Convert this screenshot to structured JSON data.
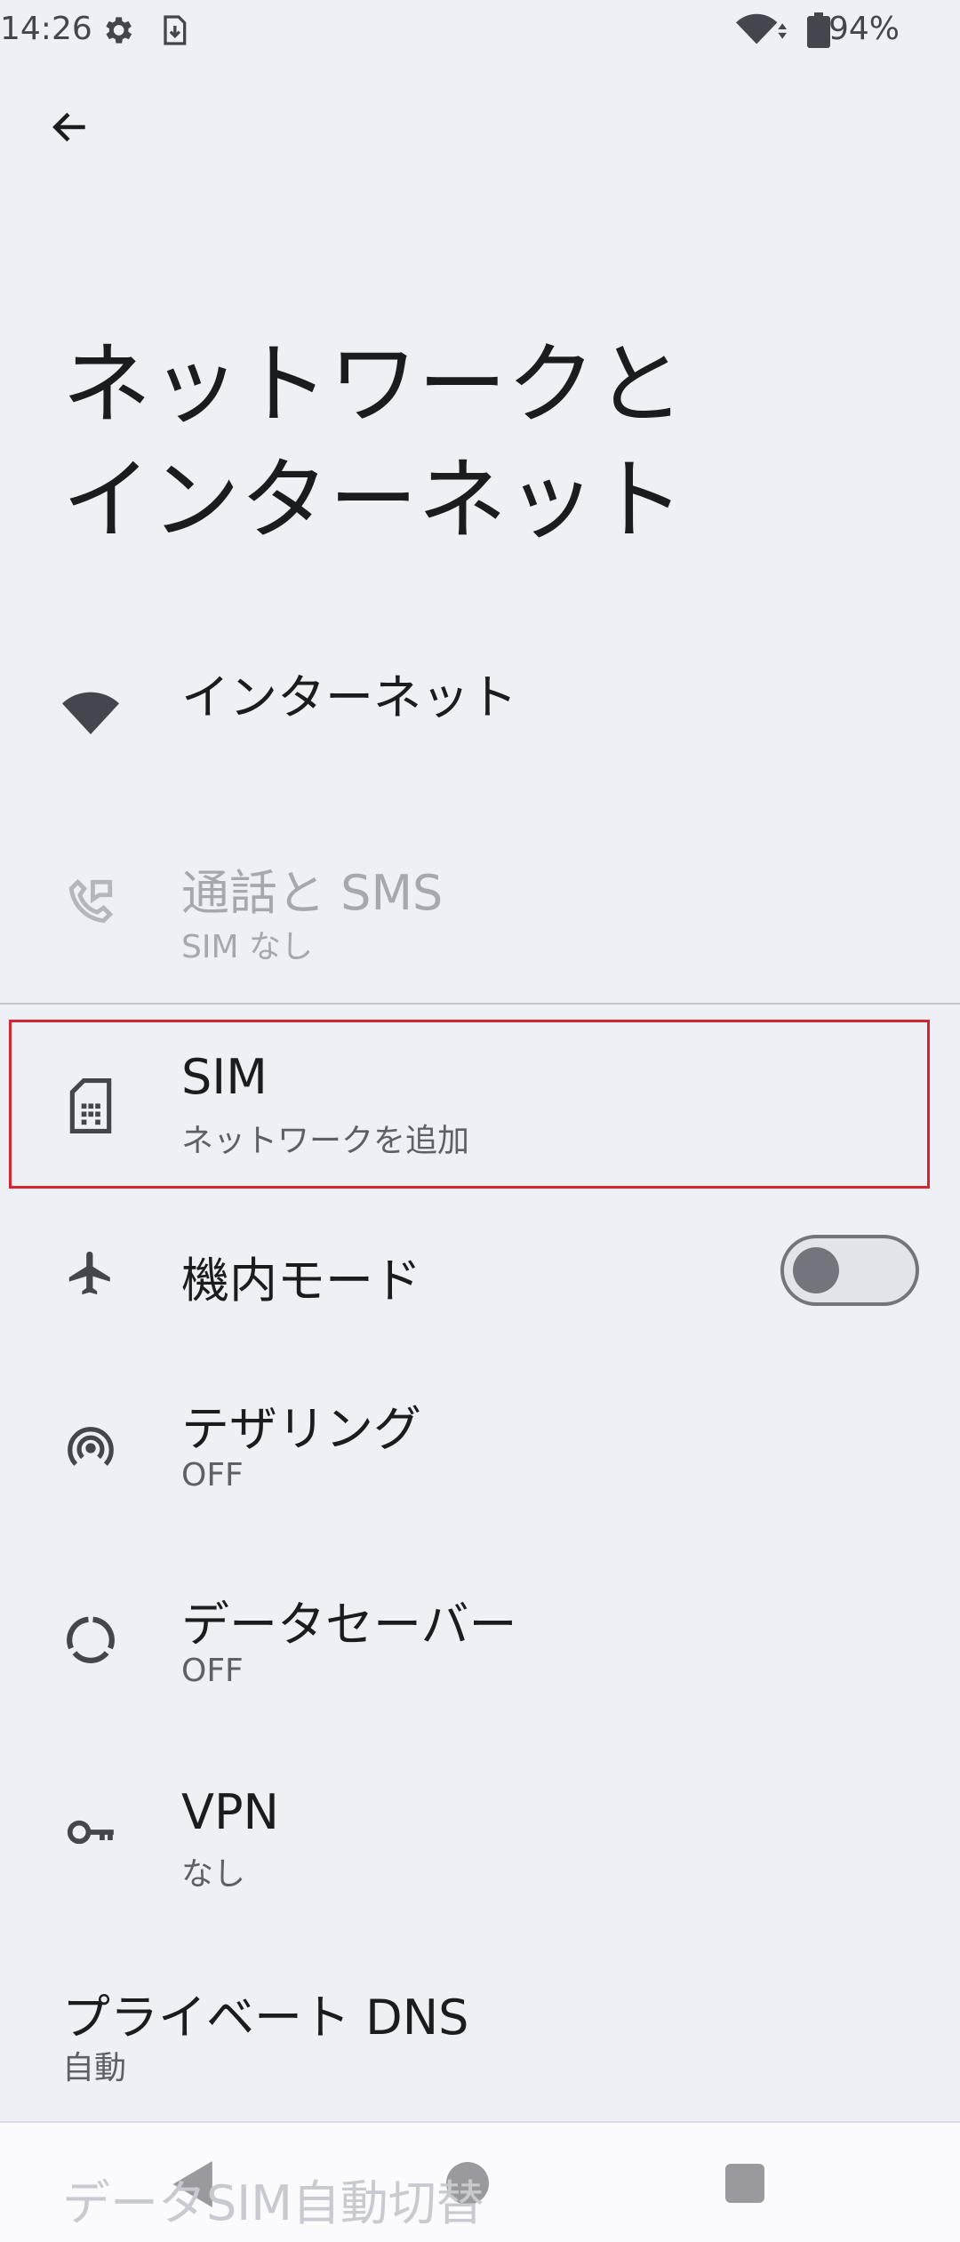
{
  "status_bar": {
    "time": "14:26",
    "battery_percent": "94%",
    "icons": [
      "gear-icon",
      "download-icon",
      "wifi-icon",
      "battery-icon"
    ]
  },
  "header": {
    "back_icon": "arrow-left-icon",
    "title_line1": "ネットワークと",
    "title_line2": "インターネット"
  },
  "items": [
    {
      "title": "インターネット",
      "subtitle": "",
      "icon": "wifi-icon"
    },
    {
      "title": "通話と SMS",
      "subtitle": "SIM なし",
      "icon": "call-sms-icon",
      "disabled": true
    },
    {
      "title": "SIM",
      "subtitle": "ネットワークを追加",
      "icon": "sim-card-icon"
    },
    {
      "title": "機内モード",
      "subtitle": "",
      "icon": "airplane-icon",
      "toggle_on": false
    },
    {
      "title": "テザリング",
      "subtitle": "OFF",
      "icon": "hotspot-icon"
    },
    {
      "title": "データセーバー",
      "subtitle": "OFF",
      "icon": "data-saver-icon"
    },
    {
      "title": "VPN",
      "subtitle": "なし",
      "icon": "vpn-key-icon"
    },
    {
      "title": "プライベート DNS",
      "subtitle": "自動"
    },
    {
      "title": "データSIM自動切替"
    }
  ],
  "nav_bar": {
    "icons": [
      "back-triangle-icon",
      "home-circle-icon",
      "recents-square-icon"
    ]
  },
  "colors": {
    "background": "#eef0f6",
    "highlight_border": "#d6252e",
    "icon": "#45464d"
  }
}
